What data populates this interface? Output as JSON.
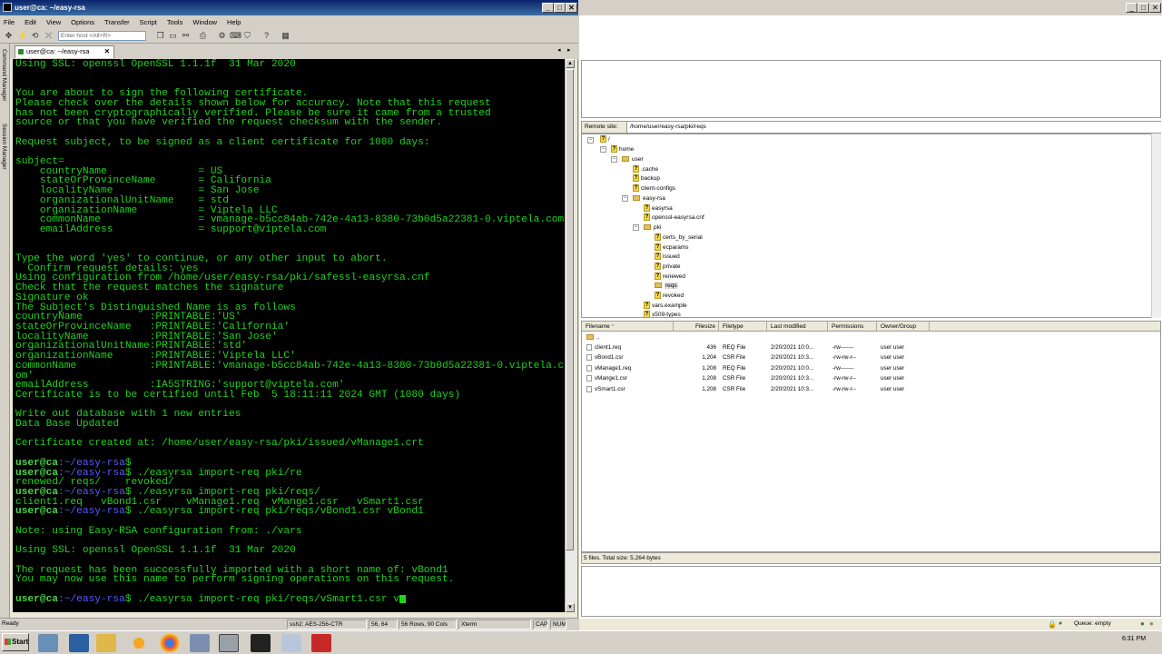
{
  "left_window": {
    "title": "user@ca: ~/easy-rsa",
    "min": "_",
    "max": "□",
    "close": "✕",
    "menu": [
      "File",
      "Edit",
      "View",
      "Options",
      "Transfer",
      "Script",
      "Tools",
      "Window",
      "Help"
    ],
    "host_placeholder": "Enter host <Alt+R>",
    "side_labels": [
      "Command Manager",
      "Session Manager"
    ],
    "tab_label": "user@ca: ~/easy-rsa",
    "tab_close": "✕",
    "tab_prev": "◂",
    "tab_next": "▸",
    "scroll_up": "▲",
    "scroll_down": "▼"
  },
  "terminal": {
    "lines": [
      "Using SSL: openssl OpenSSL 1.1.1f  31 Mar 2020",
      "",
      "",
      "You are about to sign the following certificate.",
      "Please check over the details shown below for accuracy. Note that this request",
      "has not been cryptographically verified. Please be sure it came from a trusted",
      "source or that you have verified the request checksum with the sender.",
      "",
      "Request subject, to be signed as a client certificate for 1080 days:",
      "",
      "subject=",
      "    countryName               = US",
      "    stateOrProvinceName       = California",
      "    localityName              = San Jose",
      "    organizationalUnitName    = std",
      "    organizationName          = Viptela LLC",
      "    commonName                = vmanage-b5cc84ab-742e-4a13-8380-73b0d5a22381-0.viptela.com",
      "    emailAddress              = support@viptela.com",
      "",
      "",
      "Type the word 'yes' to continue, or any other input to abort.",
      "  Confirm request details: yes",
      "Using configuration from /home/user/easy-rsa/pki/safessl-easyrsa.cnf",
      "Check that the request matches the signature",
      "Signature ok",
      "The Subject's Distinguished Name is as follows",
      "countryName           :PRINTABLE:'US'",
      "stateOrProvinceName   :PRINTABLE:'California'",
      "localityName          :PRINTABLE:'San Jose'",
      "organizationalUnitName:PRINTABLE:'std'",
      "organizationName      :PRINTABLE:'Viptela LLC'",
      "commonName            :PRINTABLE:'vmanage-b5cc84ab-742e-4a13-8380-73b0d5a22381-0.viptela.c",
      "om'",
      "emailAddress          :IA5STRING:'support@viptela.com'",
      "Certificate is to be certified until Feb  5 18:11:11 2024 GMT (1080 days)",
      "",
      "Write out database with 1 new entries",
      "Data Base Updated",
      "",
      "Certificate created at: /home/user/easy-rsa/pki/issued/vManage1.crt",
      ""
    ],
    "prompt_user": "user@ca",
    "prompt_path": ":~/easy-rsa",
    "prompt_sym": "$",
    "cmd1": "",
    "cmd2": " ./easyrsa import-req pki/re",
    "out2": "renewed/ reqs/    revoked/",
    "cmd3": " ./easyrsa import-req pki/reqs/",
    "out3": "client1.req   vBond1.csr    vManage1.req  vMange1.csr   vSmart1.csr",
    "cmd4": " ./easyrsa import-req pki/reqs/vBond1.csr vBond1",
    "lines2": [
      "",
      "Note: using Easy-RSA configuration from: ./vars",
      "",
      "Using SSL: openssl OpenSSL 1.1.1f  31 Mar 2020",
      "",
      "The request has been successfully imported with a short name of: vBond1",
      "You may now use this name to perform signing operations on this request.",
      ""
    ],
    "cmd5": " ./easyrsa import-req pki/reqs/vSmart1.csr v"
  },
  "status_bar": {
    "ready": "Ready",
    "cipher": "ssh2: AES-256-CTR",
    "pos": "56, 64",
    "size": "56 Rows, 90 Cols",
    "term": "Xterm",
    "caps": "CAP",
    "num": "NUM"
  },
  "right_window": {
    "min": "_",
    "max": "□",
    "close": "✕",
    "remote_site_label": "Remote site:",
    "remote_path": "/home/user/easy-rsa/pki/reqs",
    "tree": [
      {
        "label": "/",
        "q": true
      },
      {
        "label": "home",
        "q": true
      },
      {
        "label": "user",
        "q": false
      },
      {
        "label": ".cache",
        "q": true
      },
      {
        "label": "backup",
        "q": true
      },
      {
        "label": "client-configs",
        "q": true
      },
      {
        "label": "easy-rsa",
        "q": false
      },
      {
        "label": "easyrsa",
        "q": true
      },
      {
        "label": "openssl-easyrsa.cnf",
        "q": true
      },
      {
        "label": "pki",
        "q": false
      },
      {
        "label": "certs_by_serial",
        "q": true
      },
      {
        "label": "ecparams",
        "q": true
      },
      {
        "label": "issued",
        "q": true
      },
      {
        "label": "private",
        "q": true
      },
      {
        "label": "renewed",
        "q": true
      },
      {
        "label": "reqs",
        "q": false
      },
      {
        "label": "revoked",
        "q": true
      },
      {
        "label": "vars.example",
        "q": true
      },
      {
        "label": "x509-types",
        "q": true
      }
    ],
    "columns": [
      "Filename",
      "Filesize",
      "Filetype",
      "Last modified",
      "Permissions",
      "Owner/Group"
    ],
    "sort_arrow": "^",
    "parent_dir": "..",
    "files": [
      {
        "name": "client1.req",
        "size": "436",
        "type": "REQ File",
        "modified": "2/20/2021 10:0...",
        "perms": "-rw-------",
        "owner": "user user"
      },
      {
        "name": "vBond1.csr",
        "size": "1,204",
        "type": "CSR File",
        "modified": "2/20/2021 10:3...",
        "perms": "-rw-rw-r--",
        "owner": "user user"
      },
      {
        "name": "vManage1.req",
        "size": "1,208",
        "type": "REQ File",
        "modified": "2/20/2021 10:0...",
        "perms": "-rw-------",
        "owner": "user user"
      },
      {
        "name": "vMange1.csr",
        "size": "1,208",
        "type": "CSR File",
        "modified": "2/20/2021 10:3...",
        "perms": "-rw-rw-r--",
        "owner": "user user"
      },
      {
        "name": "vSmart1.csr",
        "size": "1,208",
        "type": "CSR File",
        "modified": "2/20/2021 10:3...",
        "perms": "-rw-rw-r--",
        "owner": "user user"
      }
    ],
    "summary": "5 files. Total size: 5,264 bytes",
    "queue": "Queue: empty"
  },
  "taskbar": {
    "start": "Start",
    "time": "6:31 PM"
  }
}
